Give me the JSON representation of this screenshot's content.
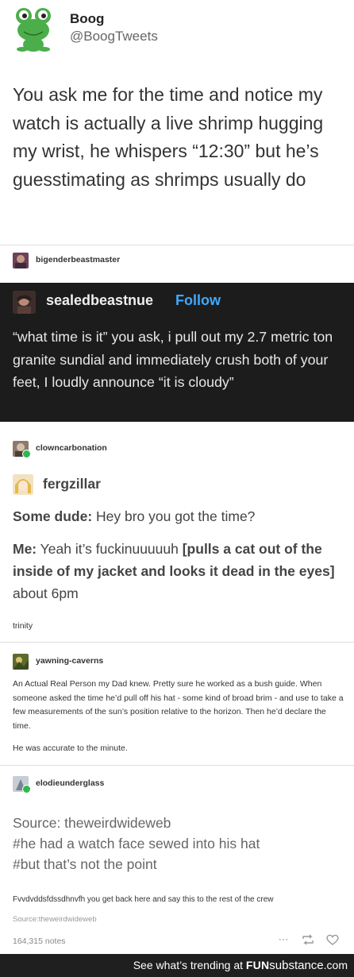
{
  "tweet": {
    "name": "Boog",
    "handle": "@BoogTweets",
    "text": "You ask me for the time and notice my watch is actually a live shrimp hugging my wrist, he whispers “12:30” but he’s guesstimating as shrimps usually do"
  },
  "reblog1": {
    "user": "bigenderbeastmaster"
  },
  "dark_post": {
    "user": "sealedbeastnue",
    "follow_label": "Follow",
    "text": "“what time is it” you ask, i pull out my 2.7 metric ton granite sundial and immediately crush both of your feet, I loudly announce “it is cloudy”"
  },
  "reblog2": {
    "user": "clowncarbonation"
  },
  "ferg": {
    "user": "fergzillar",
    "line1_speaker": "Some dude:",
    "line1_text": " Hey bro you got the time?",
    "line2_speaker": "Me:",
    "line2_text": " Yeah it’s fuckinuuuuuh ",
    "line2_action": "[pulls a cat out of the inside of my jacket and looks it dead in the eyes]",
    "line2_end": " about 6pm"
  },
  "trinity": {
    "text": "trinity"
  },
  "reblog3": {
    "user": "yawning-caverns",
    "text": "An Actual Real Person my Dad knew. Pretty sure he worked as a bush guide. When someone asked the time he’d pull off his hat - some kind of broad brim - and use to take a few measurements of the sun’s position relative to the horizon. Then he’d declare the time.",
    "text2": "He was accurate to the minute."
  },
  "reblog4": {
    "user": "elodieunderglass",
    "source_lines": [
      "Source: theweirdwideweb",
      "#he had a watch face sewed into his hat",
      "#but that’s not the point"
    ],
    "reply": "Fvvdvddsfdssdhnvfh you get back here and say this to the rest of the crew",
    "source_small": "Source:theweirdwideweb"
  },
  "footer": {
    "notes": "164,315 notes",
    "icons": [
      "more-icon",
      "reblog-icon",
      "like-icon"
    ]
  },
  "banner": {
    "prefix": "See what’s trending at ",
    "brand_fun": "FUN",
    "brand_sub": "substance",
    "brand_com": ".com"
  },
  "colors": {
    "dark_bg": "#1c1c1c",
    "follow_blue": "#41a8ff",
    "badge_green": "#2bba4f",
    "frog_green": "#4cae4a"
  }
}
